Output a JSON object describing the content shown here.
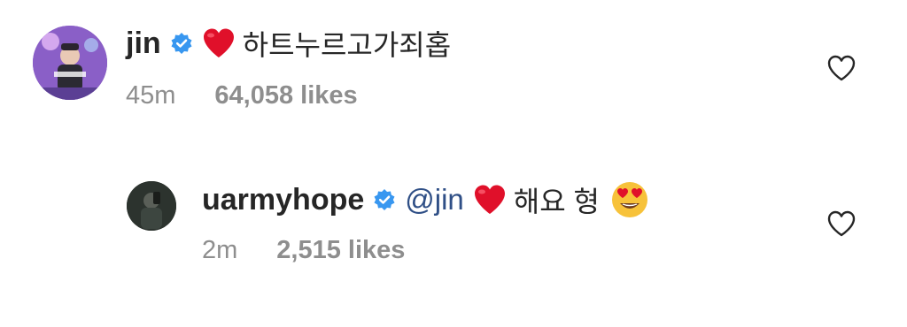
{
  "comments": [
    {
      "username": "jin",
      "avatar_icon": "avatar-photo",
      "verified_icon": "verified-badge-icon",
      "emoji_icon": "red-heart-emoji",
      "text": "하트누르고가죄홉",
      "time": "45m",
      "likes": "64,058 likes",
      "like_icon": "heart-outline-icon"
    },
    {
      "username": "uarmyhope",
      "avatar_icon": "avatar-photo",
      "verified_icon": "verified-badge-icon",
      "mention": "@jin",
      "emoji_icon": "red-heart-emoji",
      "text": "해요 형",
      "trailing_emoji_icon": "heart-eyes-emoji",
      "time": "2m",
      "likes": "2,515 likes",
      "like_icon": "heart-outline-icon"
    }
  ],
  "colors": {
    "username": "#262626",
    "meta": "#8e8e8e",
    "mention": "#2f4f86",
    "verified": "#3897f0",
    "heart": "#e0102a"
  }
}
